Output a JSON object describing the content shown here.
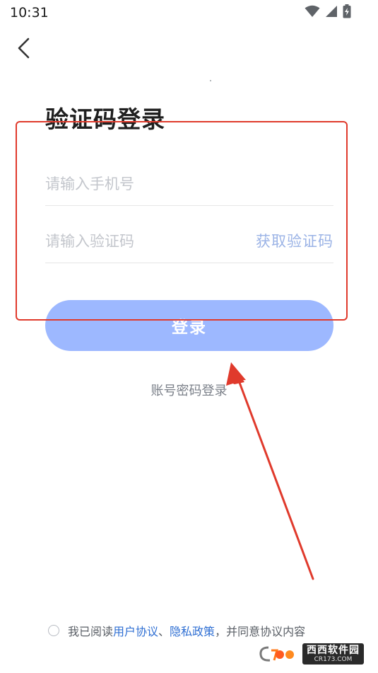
{
  "status_bar": {
    "time": "10:31",
    "icons": [
      "wifi-icon",
      "cellular-signal-icon",
      "battery-charging-icon"
    ]
  },
  "header": {
    "back_icon": "chevron-left-icon"
  },
  "main": {
    "title": "验证码登录",
    "phone_input": {
      "placeholder": "请输入手机号",
      "value": ""
    },
    "code_input": {
      "placeholder": "请输入验证码",
      "value": ""
    },
    "get_code_label": "获取验证码",
    "login_button_label": "登录",
    "password_login_label": "账号密码登录"
  },
  "agreement": {
    "prefix": "我已阅读",
    "user_agreement": "用户协议",
    "separator": "、",
    "privacy_policy": "隐私政策",
    "suffix": "，并同意协议内容"
  },
  "annotation": {
    "box_color": "#e03a2c",
    "arrow_color": "#e03a2c"
  },
  "watermark": {
    "main": "西西软件园",
    "sub": "CR173.COM"
  },
  "colors": {
    "accent": "#9db8ff",
    "link": "#2f6fd3",
    "get_code": "#9bb3e6"
  }
}
